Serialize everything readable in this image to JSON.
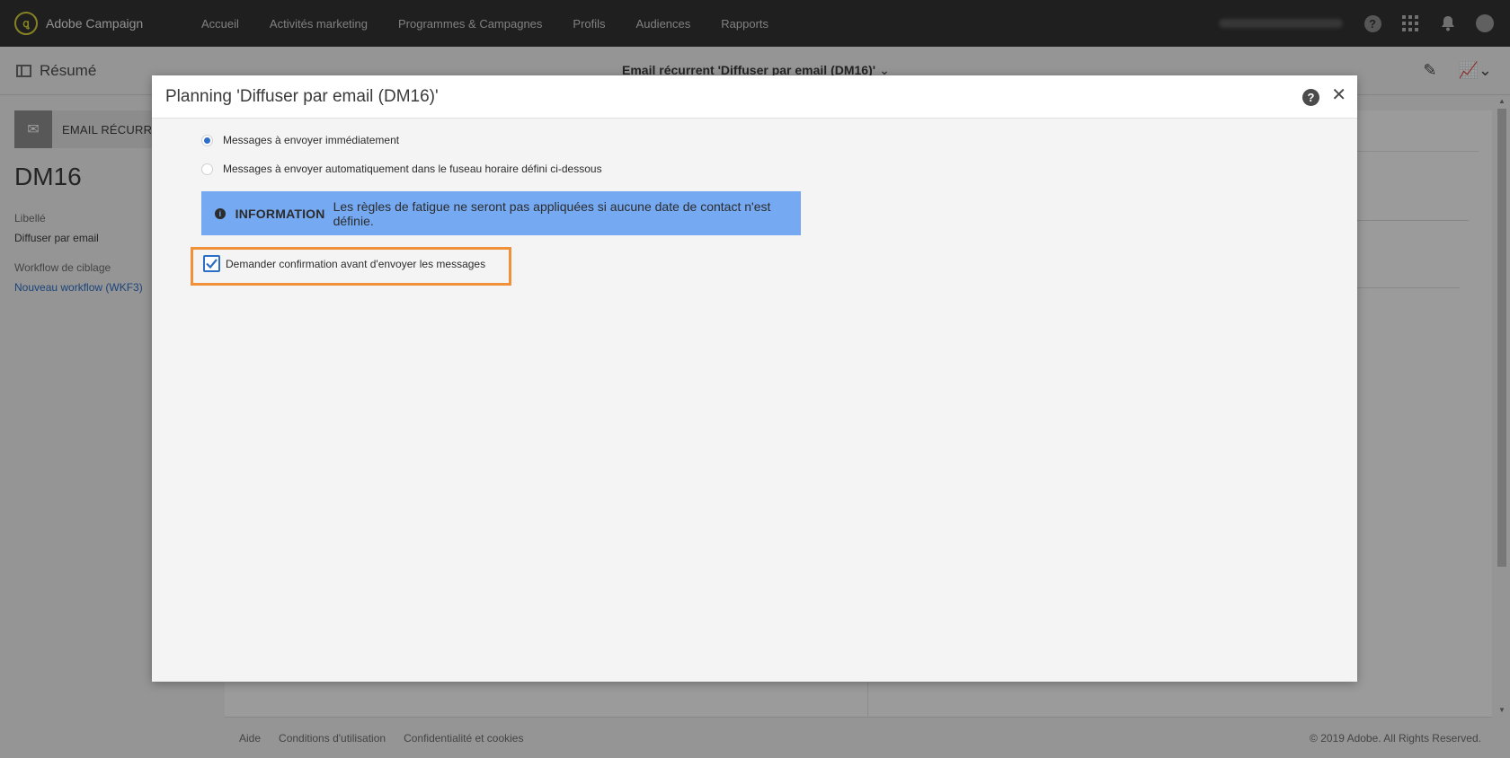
{
  "app": {
    "name": "Adobe Campaign",
    "logo_glyph": "ꝗ"
  },
  "nav": {
    "items": [
      "Accueil",
      "Activités marketing",
      "Programmes & Campagnes",
      "Profils",
      "Audiences",
      "Rapports"
    ]
  },
  "topbar": {
    "help_glyph": "?"
  },
  "subheader": {
    "summary_label": "Résumé",
    "title": "Email récurrent 'Diffuser par email (DM16)'",
    "title_chevron": "⌄",
    "edit_glyph": "✎",
    "report_glyph": "📈⌄"
  },
  "left": {
    "type_label": "EMAIL RÉCURRENT",
    "type_glyph": "✉",
    "id": "DM16",
    "libelle_label": "Libellé",
    "libelle_value": "Diffuser par email",
    "workflow_label": "Workflow de ciblage",
    "workflow_value": "Nouveau workflow (WKF3)"
  },
  "footer": {
    "links": [
      "Aide",
      "Conditions d'utilisation",
      "Confidentialité et cookies"
    ],
    "copyright": "© 2019 Adobe. All Rights Reserved."
  },
  "modal": {
    "title": "Planning 'Diffuser par email (DM16)'",
    "help_glyph": "?",
    "close_glyph": "✕",
    "radio_options": [
      {
        "label": "Messages à envoyer immédiatement",
        "selected": true
      },
      {
        "label": "Messages à envoyer automatiquement dans le fuseau horaire défini ci-dessous",
        "selected": false
      }
    ],
    "info": {
      "icon_glyph": "i",
      "title": "INFORMATION",
      "text": "Les règles de fatigue ne seront pas appliquées si aucune date de contact n'est définie."
    },
    "confirm_checkbox": {
      "label": "Demander confirmation avant d'envoyer les messages",
      "checked": true
    }
  },
  "colors": {
    "accent": "#2d6fc7",
    "highlight": "#f0913a",
    "info_bg": "#75a9f2",
    "topbar": "#323232"
  }
}
